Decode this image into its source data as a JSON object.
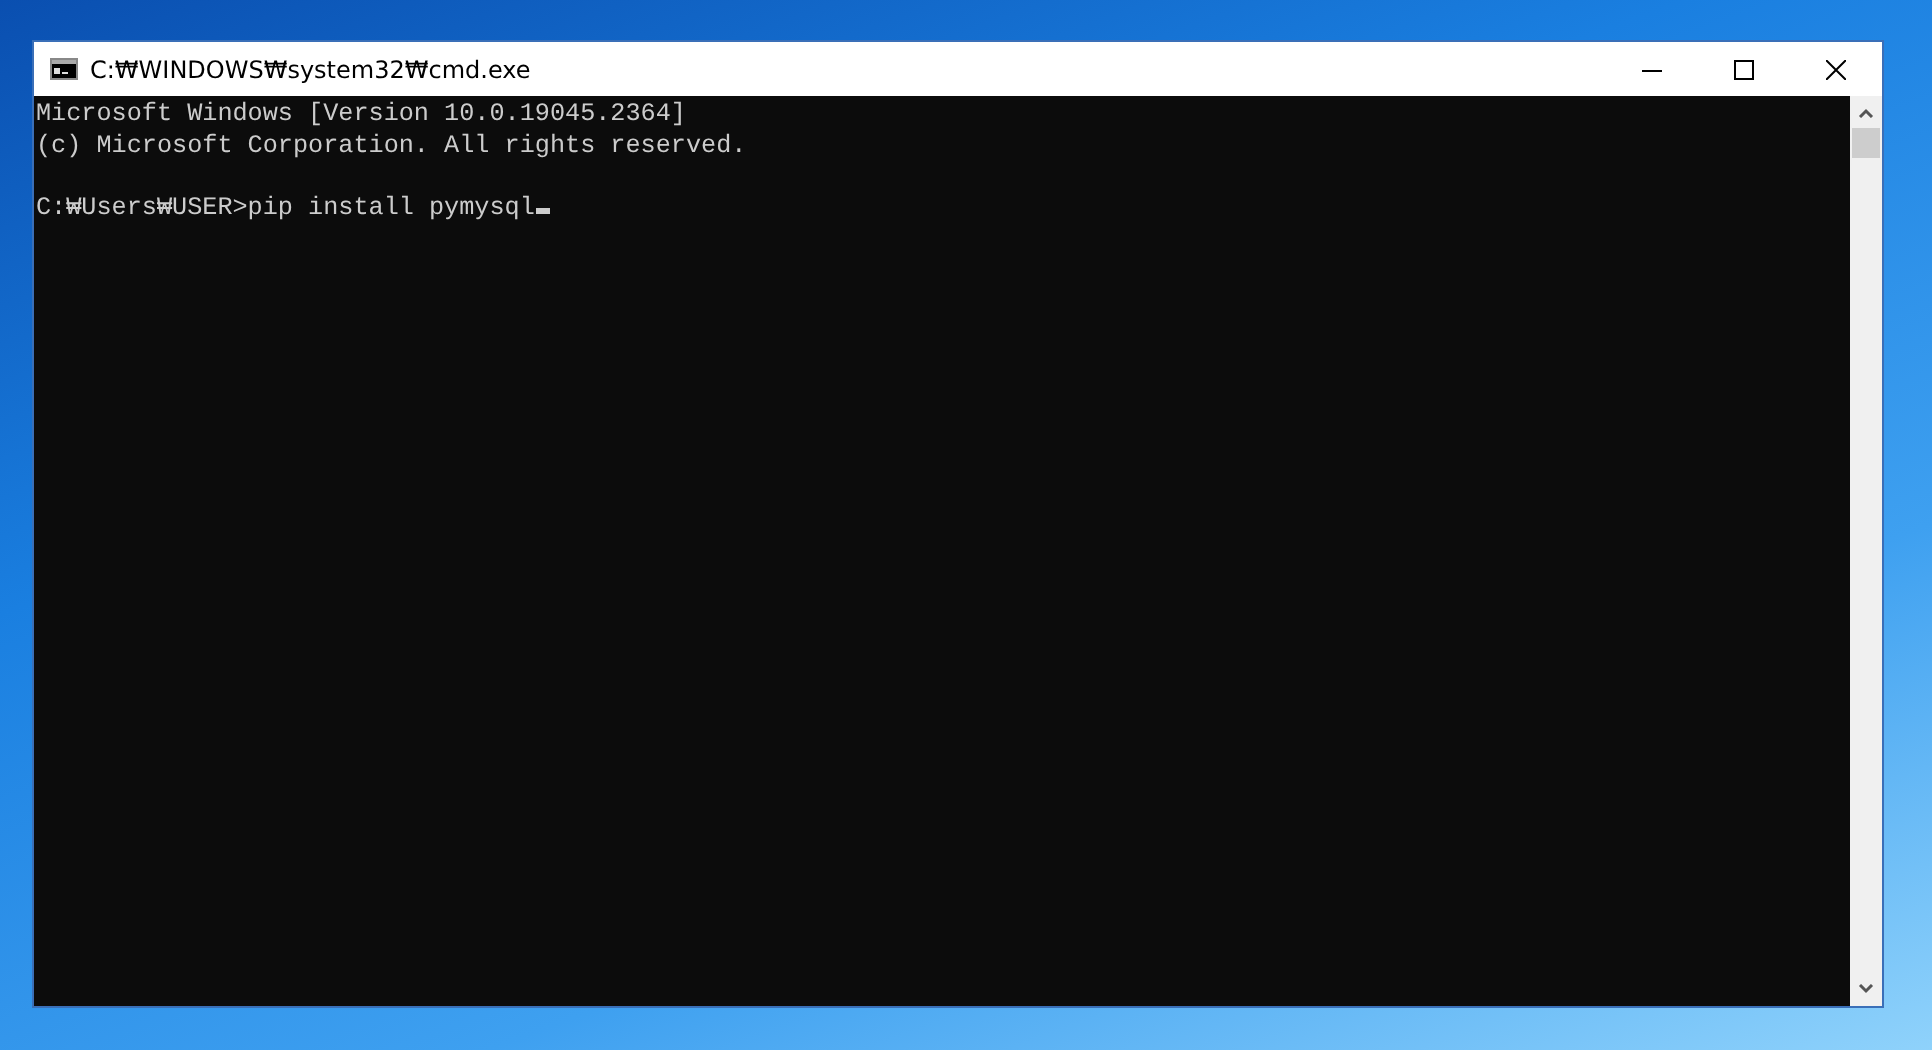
{
  "window": {
    "title": "C:₩WINDOWS₩system32₩cmd.exe"
  },
  "console": {
    "output_lines": [
      "Microsoft Windows [Version 10.0.19045.2364]",
      "(c) Microsoft Corporation. All rights reserved."
    ],
    "prompt_line": "C:₩Users₩USER>pip install pymysql"
  }
}
